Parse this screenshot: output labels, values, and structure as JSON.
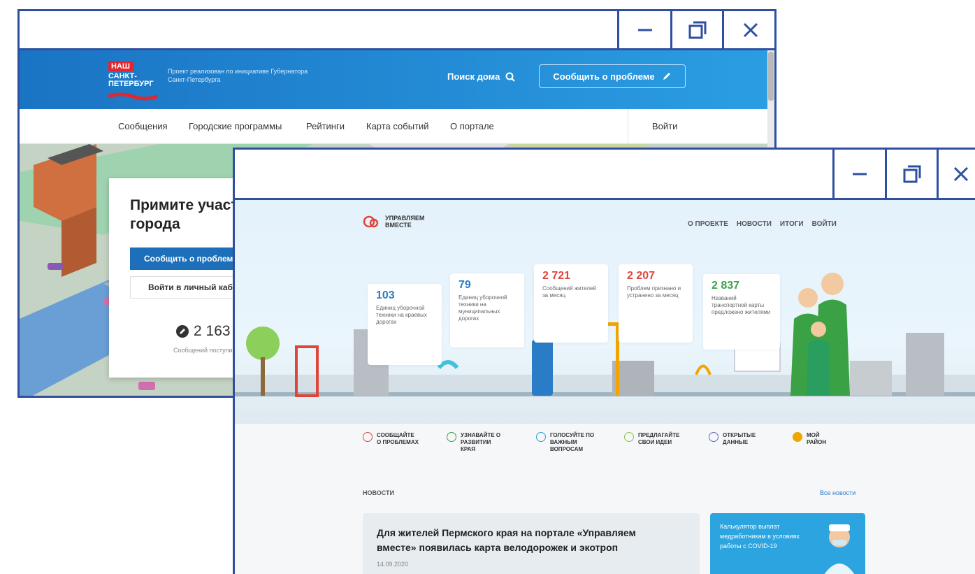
{
  "window1": {
    "header": {
      "logo_badge": "НАШ",
      "logo_line1": "САНКТ-",
      "logo_line2": "ПЕТЕРБУРГ",
      "tagline": "Проект реализован по инициативе Губернатора Санкт-Петербурга",
      "search_label": "Поиск дома",
      "report_button": "Сообщить о проблеме"
    },
    "nav": {
      "items": [
        "Сообщения",
        "Городские программы",
        "Рейтинги",
        "Карта событий",
        "О портале"
      ],
      "login": "Войти"
    },
    "hero": {
      "title": "Примите участие в жизни города",
      "report_button": "Сообщить о проблеме",
      "cabinet_button": "Войти в личный кабинет",
      "count": "2 163",
      "count_label": "Сообщений поступило"
    }
  },
  "window2": {
    "logo": {
      "line1": "УПРАВЛЯЕМ",
      "line2": "ВМЕСТЕ"
    },
    "nav": [
      "О ПРОЕКТЕ",
      "НОВОСТИ",
      "ИТОГИ",
      "ВОЙТИ"
    ],
    "stats": [
      {
        "value": "103",
        "label": "Единиц уборочной техники на краевых дорогах",
        "color": "#2a7cc7"
      },
      {
        "value": "79",
        "label": "Единиц уборочной техники на муниципальных дорогах",
        "color": "#2a7cc7"
      },
      {
        "value": "2 721",
        "label": "Сообщений жителей за месяц",
        "color": "#e0453a"
      },
      {
        "value": "2 207",
        "label": "Проблем признано и устранено за месяц",
        "color": "#e0453a"
      },
      {
        "value": "2 837",
        "label": "Названий транспортной карты предложено жителями",
        "color": "#3aa245"
      }
    ],
    "features": [
      {
        "label": "СООБЩАЙТЕ О ПРОБЛЕМАХ",
        "icon": "alert-icon",
        "color": "#e0453a"
      },
      {
        "label": "УЗНАВАЙТЕ О РАЗВИТИИ КРАЯ",
        "icon": "location-icon",
        "color": "#3aa245"
      },
      {
        "label": "ГОЛОСУЙТЕ ПО ВАЖНЫМ ВОПРОСАМ",
        "icon": "check-icon",
        "color": "#2a9fd8"
      },
      {
        "label": "ПРЕДЛАГАЙТЕ СВОИ ИДЕИ",
        "icon": "idea-icon",
        "color": "#8bc34a"
      },
      {
        "label": "ОТКРЫТЫЕ ДАННЫЕ",
        "icon": "data-icon",
        "color": "#5c6bc0"
      },
      {
        "label": "МОЙ РАЙОН",
        "icon": "district-icon",
        "color": "#f0a500"
      }
    ],
    "news": {
      "heading": "НОВОСТИ",
      "all_link": "Все новости",
      "card_title": "Для жителей Пермского края на портале «Управляем вместе» появилась карта велодорожек и экотроп",
      "card_date": "14.09.2020",
      "promo_text": "Калькулятор выплат медработникам в условиях работы с COVID-19"
    }
  }
}
